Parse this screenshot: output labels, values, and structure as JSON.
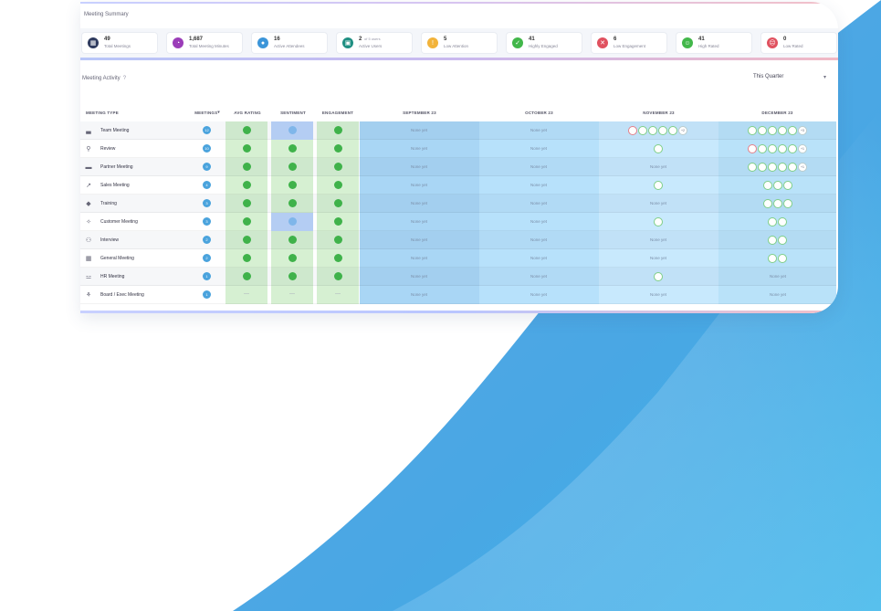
{
  "summary": {
    "title": "Meeting Summary",
    "stats": [
      {
        "icon": "calendar-icon",
        "value": "49",
        "label": "Total Meetings",
        "color": "#2e3a5e"
      },
      {
        "icon": "clock-icon",
        "value": "1,687",
        "label": "Total Meeting Minutes",
        "color": "#9b3db8"
      },
      {
        "icon": "people-icon",
        "value": "16",
        "label": "Active Attendees",
        "color": "#3b95d9"
      },
      {
        "icon": "user-icon",
        "value": "2",
        "label": "Active Users",
        "color": "#1f8f82",
        "suffix": "of 5 users"
      },
      {
        "icon": "alert-icon",
        "value": "5",
        "label": "Low Attention",
        "color": "#f2b33a"
      },
      {
        "icon": "check-icon",
        "value": "41",
        "label": "Highly Engaged",
        "color": "#42b74a"
      },
      {
        "icon": "thumb-down-icon",
        "value": "6",
        "label": "Low Engagement",
        "color": "#e0515f"
      },
      {
        "icon": "smile-icon",
        "value": "41",
        "label": "High Rated",
        "color": "#42b74a"
      },
      {
        "icon": "frown-icon",
        "value": "0",
        "label": "Low Rated",
        "color": "#e0515f"
      }
    ]
  },
  "activity": {
    "title": "Meeting Activity",
    "help": "?",
    "quarter": "This Quarter",
    "columns": {
      "type": "MEETING TYPE",
      "meetings": "MEETINGS",
      "avg_rating": "AVG RATING",
      "sentiment": "SENTIMENT",
      "engagement": "ENGAGEMENT",
      "sep": "SEPTEMBER 23",
      "oct": "OCTOBER 23",
      "nov": "NOVEMBER 23",
      "dec": "DECEMBER 23"
    },
    "none_text": "None yet",
    "dash": "—",
    "rows": [
      {
        "name": "Team Meeting",
        "icon": "chart-icon",
        "count": "12",
        "rating": "4",
        "sentiment": "blue",
        "engagement": "3",
        "nov": {
          "red": 1,
          "green": 4,
          "more": "+2"
        },
        "dec": {
          "red": 0,
          "green": 5,
          "more": "+3"
        }
      },
      {
        "name": "Review",
        "icon": "person-icon",
        "count": "10",
        "rating": "4",
        "sentiment": "green",
        "engagement": "3",
        "nov": {
          "red": 0,
          "green": 1,
          "more": ""
        },
        "dec": {
          "red": 1,
          "green": 4,
          "more": "+1"
        }
      },
      {
        "name": "Partner Meeting",
        "icon": "briefcase-icon",
        "count": "9",
        "rating": "4",
        "sentiment": "green",
        "engagement": "3",
        "nov": null,
        "dec": {
          "red": 0,
          "green": 5,
          "more": "+1"
        }
      },
      {
        "name": "Sales Meeting",
        "icon": "trend-icon",
        "count": "4",
        "rating": "4",
        "sentiment": "green",
        "engagement": "3",
        "nov": {
          "red": 0,
          "green": 1,
          "more": ""
        },
        "dec": {
          "red": 0,
          "green": 3,
          "more": ""
        }
      },
      {
        "name": "Training",
        "icon": "graduation-icon",
        "count": "3",
        "rating": "4",
        "sentiment": "green",
        "engagement": "3",
        "nov": null,
        "dec": {
          "red": 0,
          "green": 3,
          "more": ""
        }
      },
      {
        "name": "Customer Meeting",
        "icon": "handshake-icon",
        "count": "3",
        "rating": "4",
        "sentiment": "blue",
        "engagement": "3",
        "nov": {
          "red": 0,
          "green": 1,
          "more": ""
        },
        "dec": {
          "red": 0,
          "green": 2,
          "more": ""
        }
      },
      {
        "name": "Interview",
        "icon": "interview-icon",
        "count": "2",
        "rating": "4",
        "sentiment": "green",
        "engagement": "3",
        "nov": null,
        "dec": {
          "red": 0,
          "green": 2,
          "more": ""
        }
      },
      {
        "name": "General Meeting",
        "icon": "calendar-icon",
        "count": "2",
        "rating": "4",
        "sentiment": "green",
        "engagement": "3",
        "nov": null,
        "dec": {
          "red": 0,
          "green": 2,
          "more": ""
        }
      },
      {
        "name": "HR Meeting",
        "icon": "group-icon",
        "count": "1",
        "rating": "4",
        "sentiment": "green",
        "engagement": "3",
        "nov": {
          "red": 0,
          "green": 1,
          "more": ""
        },
        "dec": null
      },
      {
        "name": "Board / Exec Meeting",
        "icon": "org-icon",
        "count": "1",
        "rating": null,
        "sentiment": null,
        "engagement": null,
        "nov": null,
        "dec": null
      }
    ]
  }
}
